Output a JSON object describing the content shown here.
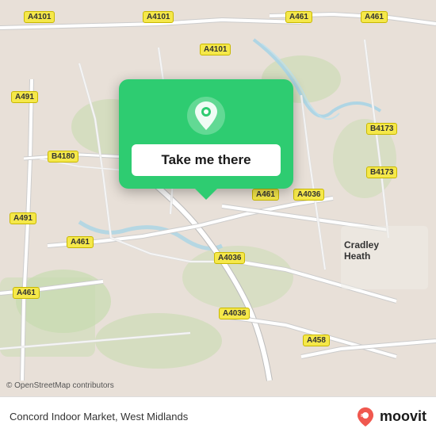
{
  "map": {
    "background_color": "#e8e0d8",
    "road_color": "#ffffff",
    "road_outline": "#cccccc",
    "green_area": "#c8dbb0",
    "water_color": "#a8d4e6"
  },
  "popup": {
    "background": "#2ecc71",
    "button_label": "Take me there",
    "button_bg": "#ffffff",
    "icon_type": "location-pin-icon"
  },
  "road_labels": [
    {
      "id": "r1",
      "text": "A4101",
      "top": "14",
      "left": "30"
    },
    {
      "id": "r2",
      "text": "A4101",
      "top": "14",
      "left": "180"
    },
    {
      "id": "r3",
      "text": "A461",
      "top": "14",
      "left": "350"
    },
    {
      "id": "r4",
      "text": "A461",
      "top": "14",
      "left": "450"
    },
    {
      "id": "r5",
      "text": "A4101",
      "top": "55",
      "left": "250"
    },
    {
      "id": "r6",
      "text": "A491",
      "top": "120",
      "left": "18"
    },
    {
      "id": "r7",
      "text": "B4180",
      "top": "185",
      "left": "60"
    },
    {
      "id": "r8",
      "text": "B4173",
      "top": "160",
      "left": "465"
    },
    {
      "id": "r9",
      "text": "A491",
      "top": "265",
      "left": "18"
    },
    {
      "id": "r10",
      "text": "A461",
      "top": "295",
      "left": "90"
    },
    {
      "id": "r11",
      "text": "A461",
      "top": "235",
      "left": "320"
    },
    {
      "id": "r12",
      "text": "A4036",
      "top": "235",
      "left": "370"
    },
    {
      "id": "r13",
      "text": "A4036",
      "top": "320",
      "left": "270"
    },
    {
      "id": "r14",
      "text": "A4036",
      "top": "390",
      "left": "280"
    },
    {
      "id": "r15",
      "text": "A461",
      "top": "360",
      "left": "20"
    },
    {
      "id": "r16",
      "text": "A458",
      "top": "420",
      "left": "380"
    },
    {
      "id": "r17",
      "text": "B4173",
      "top": "210",
      "left": "465"
    }
  ],
  "place_labels": [
    {
      "id": "p1",
      "text": "Cradley Heath",
      "top": "300",
      "left": "436"
    }
  ],
  "bottom_bar": {
    "osm_credit": "© OpenStreetMap contributors",
    "location_text": "Concord Indoor Market, West Midlands",
    "brand_name": "moovit"
  }
}
